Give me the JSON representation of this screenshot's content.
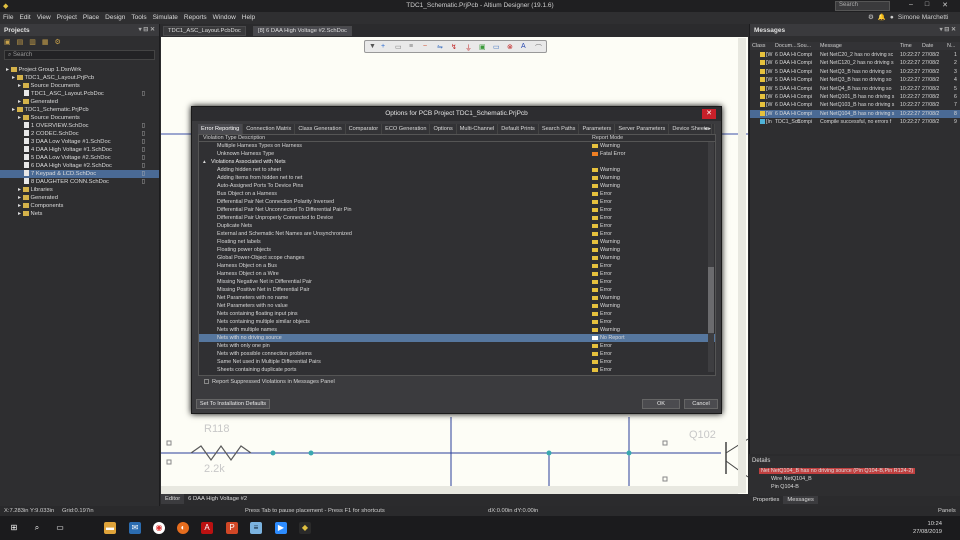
{
  "window": {
    "title": "TDC1_Schematic.PrjPcb - Altium Designer (19.1.6)",
    "search_placeholder": "Search",
    "user": "Simone Marchetti"
  },
  "menu": [
    "File",
    "Edit",
    "View",
    "Project",
    "Place",
    "Design",
    "Tools",
    "Simulate",
    "Reports",
    "Window",
    "Help"
  ],
  "projects_panel": {
    "title": "Projects",
    "search_placeholder": "Search",
    "tree": [
      {
        "label": "Project Group 1.DsnWrk",
        "indent": 0,
        "type": "group"
      },
      {
        "label": "TDC1_ASC_Layout.PrjPcb",
        "indent": 1,
        "type": "project"
      },
      {
        "label": "Source Documents",
        "indent": 2,
        "type": "folder"
      },
      {
        "label": "TDC1_ASC_Layout.PcbDoc",
        "indent": 3,
        "type": "doc"
      },
      {
        "label": "Generated",
        "indent": 2,
        "type": "folder"
      },
      {
        "label": "TDC1_Schematic.PrjPcb",
        "indent": 1,
        "type": "project"
      },
      {
        "label": "Source Documents",
        "indent": 2,
        "type": "folder"
      },
      {
        "label": "1 OVERVIEW.SchDoc",
        "indent": 3,
        "type": "doc"
      },
      {
        "label": "2 CODEC.SchDoc",
        "indent": 3,
        "type": "doc"
      },
      {
        "label": "3 DAA Low Voltage #1.SchDoc",
        "indent": 3,
        "type": "doc"
      },
      {
        "label": "4 DAA High Voltage #1.SchDoc",
        "indent": 3,
        "type": "doc"
      },
      {
        "label": "5 DAA Low Voltage #2.SchDoc",
        "indent": 3,
        "type": "doc"
      },
      {
        "label": "6 DAA High Voltage #2.SchDoc",
        "indent": 3,
        "type": "doc"
      },
      {
        "label": "7 Keypad & LCD.SchDoc",
        "indent": 3,
        "type": "doc",
        "selected": true
      },
      {
        "label": "8 DAUGHTER CONN.SchDoc",
        "indent": 3,
        "type": "doc"
      },
      {
        "label": "Libraries",
        "indent": 2,
        "type": "folder"
      },
      {
        "label": "Generated",
        "indent": 2,
        "type": "folder"
      },
      {
        "label": "Components",
        "indent": 2,
        "type": "folder"
      },
      {
        "label": "Nets",
        "indent": 2,
        "type": "folder"
      }
    ]
  },
  "doc_tabs": [
    "TDC1_ASC_Layout.PcbDoc",
    "[8] 6 DAA High Voltage #2.SchDoc"
  ],
  "schematic": {
    "labels": [
      "R118",
      "2.2k",
      "Q102"
    ]
  },
  "dialog": {
    "title": "Options for PCB Project TDC1_Schematic.PrjPcb",
    "tabs": [
      "Error Reporting",
      "Connection Matrix",
      "Class Generation",
      "Comparator",
      "ECO Generation",
      "Options",
      "Multi-Channel",
      "Default Prints",
      "Search Paths",
      "Parameters",
      "Server Parameters",
      "Device Sheets"
    ],
    "col_violation": "Violation Type Description",
    "col_mode": "Report Mode",
    "rows": [
      {
        "name": "Multiple Harness Types on Harness",
        "mode": "Warning"
      },
      {
        "name": "Unknown Harness Type",
        "mode": "Fatal Error"
      },
      {
        "name": "Violations Associated with Nets",
        "mode": "",
        "group": true
      },
      {
        "name": "Adding hidden net to sheet",
        "mode": "Warning"
      },
      {
        "name": "Adding Items from hidden net to net",
        "mode": "Warning"
      },
      {
        "name": "Auto-Assigned Ports To Device Pins",
        "mode": "Warning"
      },
      {
        "name": "Bus Object on a Harness",
        "mode": "Error"
      },
      {
        "name": "Differential Pair Net Connection Polarity Inversed",
        "mode": "Error"
      },
      {
        "name": "Differential Pair Net Unconnected To Differential Pair Pin",
        "mode": "Error"
      },
      {
        "name": "Differential Pair Unproperly Connected to Device",
        "mode": "Error"
      },
      {
        "name": "Duplicate Nets",
        "mode": "Error"
      },
      {
        "name": "External and Schematic Net Names are Unsynchronized",
        "mode": "Error"
      },
      {
        "name": "Floating net labels",
        "mode": "Warning"
      },
      {
        "name": "Floating power objects",
        "mode": "Warning"
      },
      {
        "name": "Global Power-Object scope changes",
        "mode": "Warning"
      },
      {
        "name": "Harness Object on a Bus",
        "mode": "Error"
      },
      {
        "name": "Harness Object on a Wire",
        "mode": "Error"
      },
      {
        "name": "Missing Negative Net in Differential Pair",
        "mode": "Error"
      },
      {
        "name": "Missing Positive Net in Differential Pair",
        "mode": "Error"
      },
      {
        "name": "Net Parameters with no name",
        "mode": "Warning"
      },
      {
        "name": "Net Parameters with no value",
        "mode": "Warning"
      },
      {
        "name": "Nets containing floating input pins",
        "mode": "Error"
      },
      {
        "name": "Nets containing multiple similar objects",
        "mode": "Error"
      },
      {
        "name": "Nets with multiple names",
        "mode": "Warning"
      },
      {
        "name": "Nets with no driving source",
        "mode": "No Report",
        "selected": true
      },
      {
        "name": "Nets with only one pin",
        "mode": "Error"
      },
      {
        "name": "Nets with possible connection problems",
        "mode": "Error"
      },
      {
        "name": "Same Net used in Multiple Differential Pairs",
        "mode": "Error"
      },
      {
        "name": "Sheets containing duplicate ports",
        "mode": "Error"
      }
    ],
    "checkbox_label": "Report Suppressed Violations in Messages Panel",
    "defaults_button": "Set To Installation Defaults",
    "ok_button": "OK",
    "cancel_button": "Cancel"
  },
  "messages_panel": {
    "title": "Messages",
    "columns": [
      "Class",
      "Docum...",
      "Sou...",
      "Message",
      "Time",
      "Date",
      "N..."
    ],
    "rows": [
      {
        "cls": "[W",
        "doc": "6 DAA Hi",
        "src": "Compi",
        "msg": "Net NetC20_2 has no driving sc",
        "time": "10:22:27",
        "date": "27/08/2",
        "n": "1"
      },
      {
        "cls": "[W",
        "doc": "6 DAA Hi",
        "src": "Compi",
        "msg": "Net NetC120_2 has no driving s",
        "time": "10:22:27",
        "date": "27/08/2",
        "n": "2"
      },
      {
        "cls": "[W",
        "doc": "5 DAA Hi",
        "src": "Compi",
        "msg": "Net NetQ3_B has no driving so",
        "time": "10:22:27",
        "date": "27/08/2",
        "n": "3"
      },
      {
        "cls": "[W",
        "doc": "5 DAA Hi",
        "src": "Compi",
        "msg": "Net NetQ3_B has no driving so",
        "time": "10:22:27",
        "date": "27/08/2",
        "n": "4"
      },
      {
        "cls": "[W",
        "doc": "5 DAA Hi",
        "src": "Compi",
        "msg": "Net NetQ4_B has no driving so",
        "time": "10:22:27",
        "date": "27/08/2",
        "n": "5"
      },
      {
        "cls": "[W",
        "doc": "6 DAA Hi",
        "src": "Compi",
        "msg": "Net NetQ101_B has no driving s",
        "time": "10:22:27",
        "date": "27/08/2",
        "n": "6"
      },
      {
        "cls": "[W",
        "doc": "6 DAA Hi",
        "src": "Compi",
        "msg": "Net NetQ103_B has no driving s",
        "time": "10:22:27",
        "date": "27/08/2",
        "n": "7"
      },
      {
        "cls": "[W",
        "doc": "6 DAA Hi",
        "src": "Compi",
        "msg": "Net NetQ104_B has no driving s",
        "time": "10:22:27",
        "date": "27/08/2",
        "n": "8",
        "selected": true
      },
      {
        "cls": "[In",
        "doc": "TDC1_Sch",
        "src": "Compi",
        "msg": "Compile successful, no errors f",
        "time": "10:22:27",
        "date": "27/08/2",
        "n": "9",
        "info": true
      }
    ],
    "details_title": "Details",
    "details": [
      "Net NetQ104_B has no driving source (Pin Q104-B,Pin R124-2)",
      "Wire NetQ104_B",
      "Pin Q104-B"
    ],
    "bottom_tabs": [
      "Properties",
      "Messages"
    ]
  },
  "bottom_tabs": [
    "Editor",
    "6 DAA High Voltage #2"
  ],
  "status": {
    "coords": "X:7.283in Y:9.033in",
    "grid": "Grid:0.197in",
    "hint": "Press Tab to pause placement - Press F1 for shortcuts",
    "delta": "dX:0.00in dY:0.00in",
    "panels": "Panels"
  },
  "clock": {
    "time": "10:24",
    "date": "27/08/2019"
  }
}
